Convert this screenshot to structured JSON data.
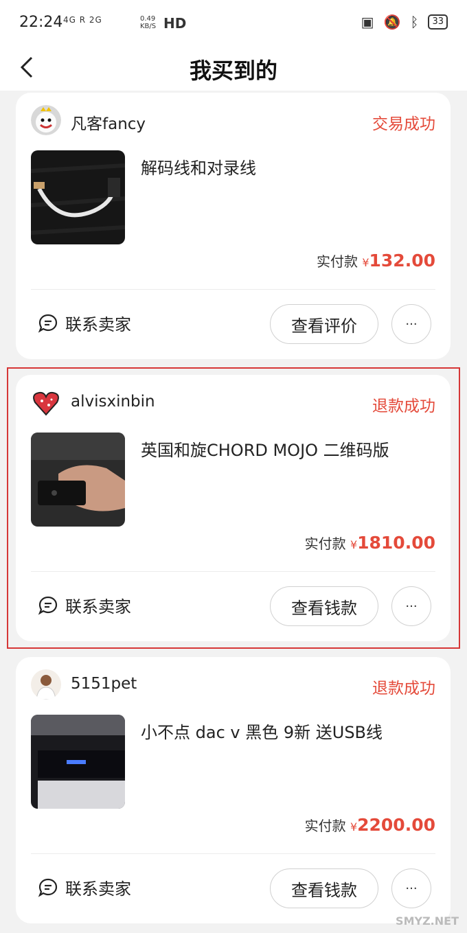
{
  "status_bar": {
    "time": "22:24",
    "network": "4G  R 2G",
    "speed": "0.49\nKB/S",
    "hd": "HD",
    "battery": "33"
  },
  "header": {
    "title": "我买到的"
  },
  "orders": [
    {
      "seller": "凡客fancy",
      "status": "交易成功",
      "title": "解码线和对录线",
      "paid_label": "实付款",
      "currency": "¥",
      "amount": "132.00",
      "contact_label": "联系卖家",
      "action_label": "查看评价",
      "more_label": "···"
    },
    {
      "seller": "alvisxinbin",
      "status": "退款成功",
      "title": "英国和旋CHORD MOJO 二维码版",
      "paid_label": "实付款",
      "currency": "¥",
      "amount": "1810.00",
      "contact_label": "联系卖家",
      "action_label": "查看钱款",
      "more_label": "···"
    },
    {
      "seller": "5151pet",
      "status": "退款成功",
      "title": "小不点 dac v 黑色 9新 送USB线",
      "paid_label": "实付款",
      "currency": "¥",
      "amount": "2200.00",
      "contact_label": "联系卖家",
      "action_label": "查看钱款",
      "more_label": "···"
    }
  ],
  "watermark": "SMYZ.NET",
  "colors": {
    "accent": "#e44a3a",
    "highlight": "#d63636",
    "background": "#f2f2f2"
  }
}
